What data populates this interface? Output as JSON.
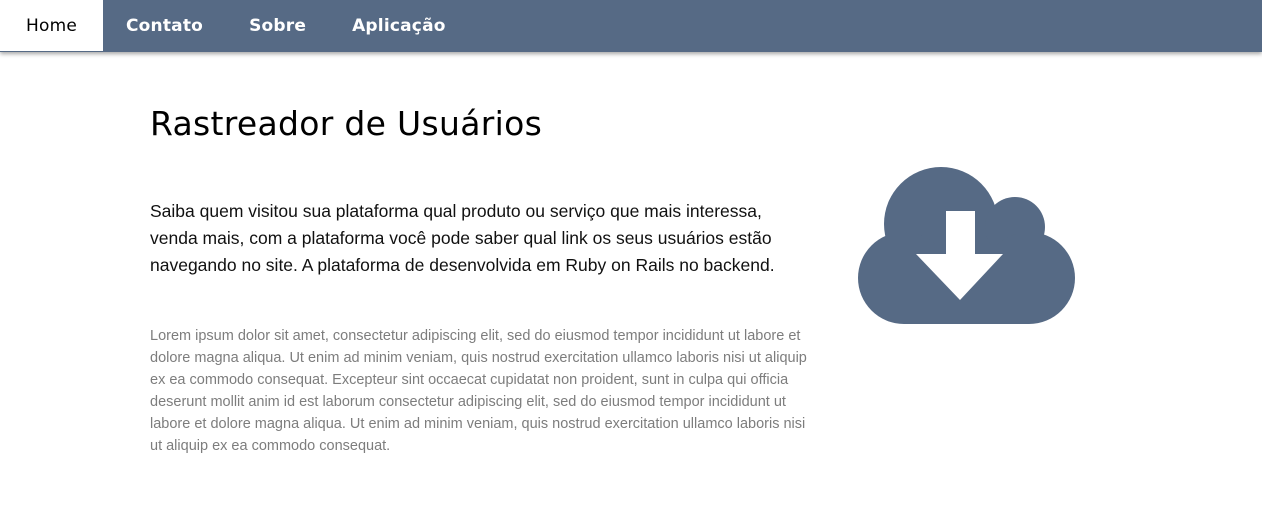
{
  "nav": {
    "items": [
      {
        "label": "Home"
      },
      {
        "label": "Contato"
      },
      {
        "label": "Sobre"
      },
      {
        "label": "Aplicação"
      }
    ]
  },
  "main": {
    "title": "Rastreador de Usuários",
    "lead": "Saiba quem visitou sua plataforma qual produto ou serviço que mais interessa, venda mais, com a plataforma você pode saber qual link os seus usuários estão navegando no site. A plataforma de desenvolvida em Ruby on Rails no backend.",
    "body": "Lorem ipsum dolor sit amet, consectetur adipiscing elit, sed do eiusmod tempor incididunt ut labore et dolore magna aliqua. Ut enim ad minim veniam, quis nostrud exercitation ullamco laboris nisi ut aliquip ex ea commodo consequat. Excepteur sint occaecat cupidatat non proident, sunt in culpa qui officia deserunt mollit anim id est laborum consectetur adipiscing elit, sed do eiusmod tempor incididunt ut labore et dolore magna aliqua. Ut enim ad minim veniam, quis nostrud exercitation ullamco laboris nisi ut aliquip ex ea commodo consequat."
  },
  "icon": {
    "name": "cloud-download-icon"
  },
  "colors": {
    "navbar": "#566a85",
    "icon": "#566a85",
    "active_tab": "#ffffff",
    "muted_text": "#7d7d7d"
  }
}
